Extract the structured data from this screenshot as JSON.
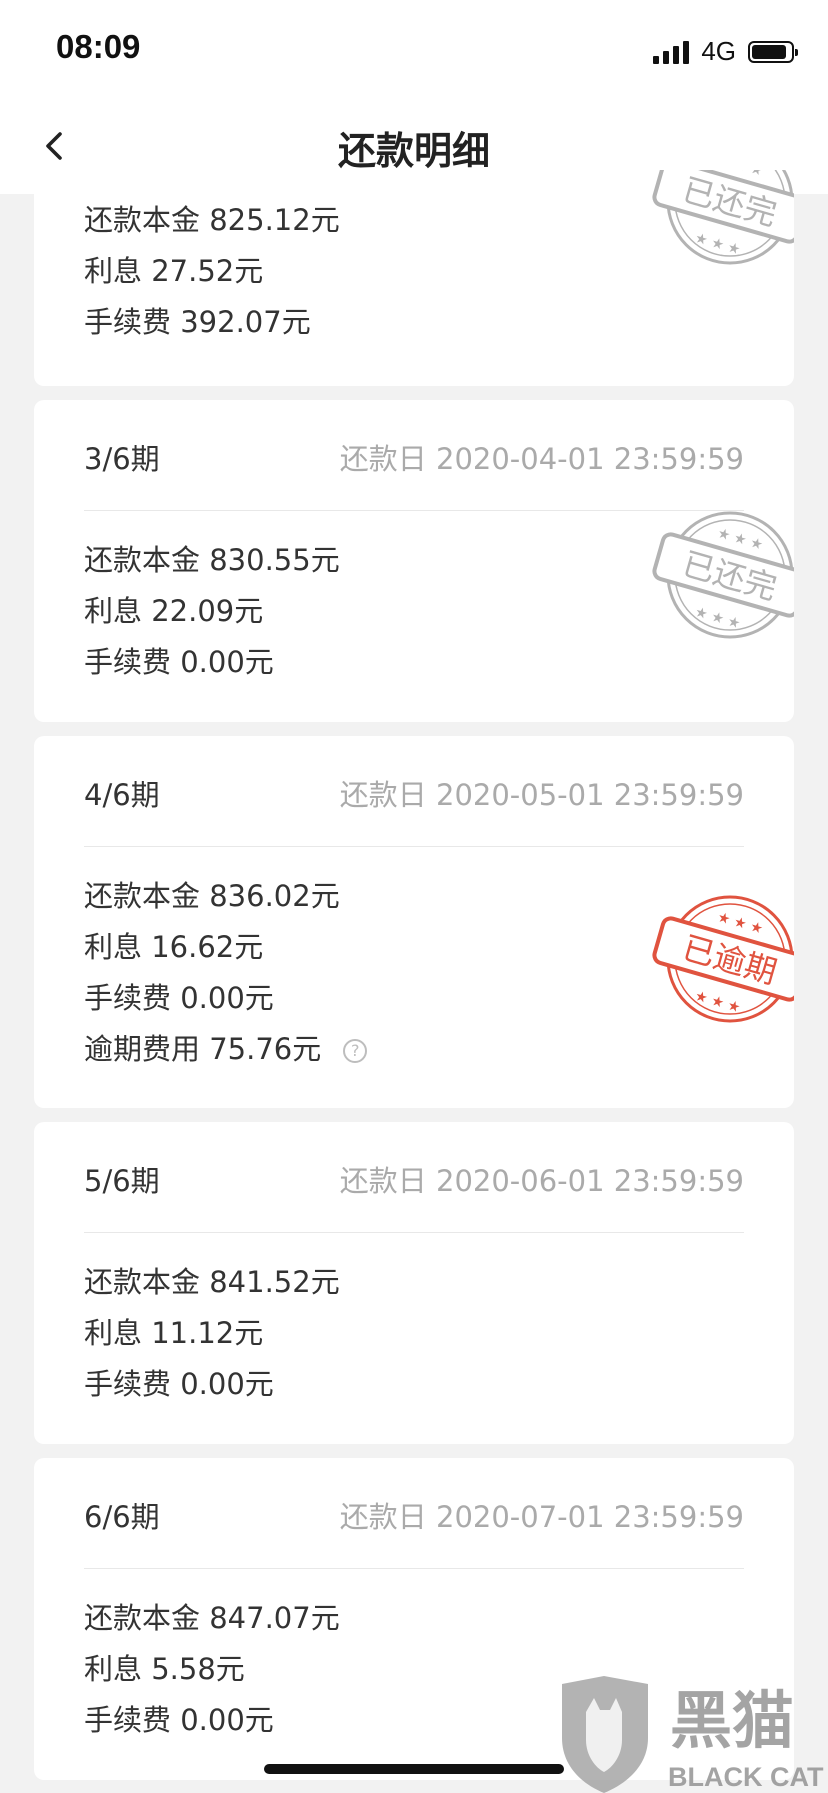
{
  "status": {
    "time": "08:09",
    "network": "4G"
  },
  "nav": {
    "title": "还款明细"
  },
  "stamp_texts": {
    "paid": "已还完",
    "overdue": "已逾期"
  },
  "colors": {
    "paid_stamp": "#b3b3b3",
    "overdue_stamp": "#e0533f",
    "page_bg": "#f2f2f2"
  },
  "installments": [
    {
      "lines": [
        {
          "text": "还款本金 825.12元"
        },
        {
          "text": "利息 27.52元"
        },
        {
          "text": "手续费 392.07元"
        }
      ]
    },
    {
      "period": "3/6期",
      "due": "还款日 2020-04-01 23:59:59",
      "lines": [
        {
          "text": "还款本金 830.55元"
        },
        {
          "text": "利息 22.09元"
        },
        {
          "text": "手续费 0.00元"
        }
      ]
    },
    {
      "period": "4/6期",
      "due": "还款日 2020-05-01 23:59:59",
      "lines": [
        {
          "text": "还款本金 836.02元"
        },
        {
          "text": "利息 16.62元"
        },
        {
          "text": "手续费 0.00元"
        },
        {
          "text": "逾期费用 75.76元"
        }
      ]
    },
    {
      "period": "5/6期",
      "due": "还款日 2020-06-01 23:59:59",
      "lines": [
        {
          "text": "还款本金 841.52元"
        },
        {
          "text": "利息 11.12元"
        },
        {
          "text": "手续费 0.00元"
        }
      ]
    },
    {
      "period": "6/6期",
      "due": "还款日 2020-07-01 23:59:59",
      "lines": [
        {
          "text": "还款本金 847.07元"
        },
        {
          "text": "利息 5.58元"
        },
        {
          "text": "手续费 0.00元"
        }
      ]
    }
  ],
  "watermark": {
    "cn": "黑猫",
    "en": "BLACK CAT"
  }
}
